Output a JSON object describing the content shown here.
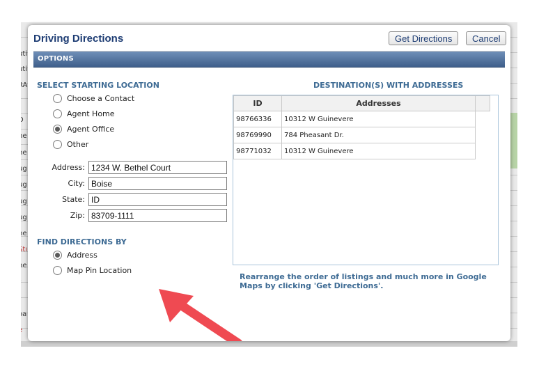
{
  "dialog": {
    "title": "Driving Directions",
    "get_directions_label": "Get Directions",
    "cancel_label": "Cancel",
    "options_label": "OPTIONS"
  },
  "starting_location": {
    "heading": "SELECT STARTING LOCATION",
    "options": [
      {
        "label": "Choose a Contact",
        "checked": false
      },
      {
        "label": "Agent Home",
        "checked": false
      },
      {
        "label": "Agent Office",
        "checked": true
      },
      {
        "label": "Other",
        "checked": false
      }
    ],
    "fields": {
      "address_label": "Address:",
      "address_value": "1234 W. Bethel Court",
      "city_label": "City:",
      "city_value": "Boise",
      "state_label": "State:",
      "state_value": "ID",
      "zip_label": "Zip:",
      "zip_value": "83709-1111"
    }
  },
  "find_by": {
    "heading": "FIND DIRECTIONS BY",
    "options": [
      {
        "label": "Address",
        "checked": true
      },
      {
        "label": "Map Pin Location",
        "checked": false
      }
    ]
  },
  "destinations": {
    "heading": "DESTINATION(S) WITH ADDRESSES",
    "columns": [
      "ID",
      "Addresses"
    ],
    "rows": [
      {
        "id": "98766336",
        "address": "10312 W Guinevere"
      },
      {
        "id": "98769990",
        "address": "784 Pheasant Dr."
      },
      {
        "id": "98771032",
        "address": "10312 W Guinevere"
      }
    ],
    "note": "Rearrange the order of listings and much more in Google Maps by clicking 'Get Directions'."
  },
  "background": {
    "fragments": [
      "uti",
      "uti",
      "RA",
      "D",
      "ne",
      "ne",
      "ug",
      "ug",
      "ug",
      "ug",
      "ne",
      "Stı",
      "ne",
      "r",
      "oa",
      "e"
    ]
  },
  "colors": {
    "accent": "#1d3c73",
    "section": "#3e6b94",
    "options_bar": "#4f6f9a",
    "arrow": "#ef4a52"
  },
  "icons": {
    "annotation": "red-arrow-icon"
  }
}
